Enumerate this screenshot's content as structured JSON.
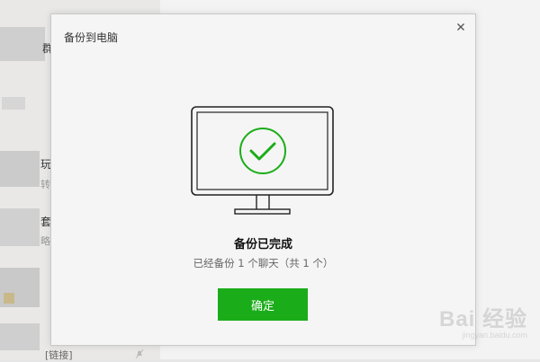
{
  "background": {
    "chat_snippets": [
      {
        "text": "群"
      },
      {
        "text": "玩"
      },
      {
        "text": "转"
      },
      {
        "text": "套"
      },
      {
        "text": "略"
      },
      {
        "text": "[链接]"
      }
    ]
  },
  "dialog": {
    "title": "备份到电脑",
    "close_icon": "close-icon",
    "status_title": "备份已完成",
    "status_detail": "已经备份 1 个聊天（共 1 个）",
    "confirm_label": "确定",
    "accent_color": "#1aad19"
  },
  "watermark": {
    "brand": "Bai 经验",
    "url": "jingyan.baidu.com"
  }
}
